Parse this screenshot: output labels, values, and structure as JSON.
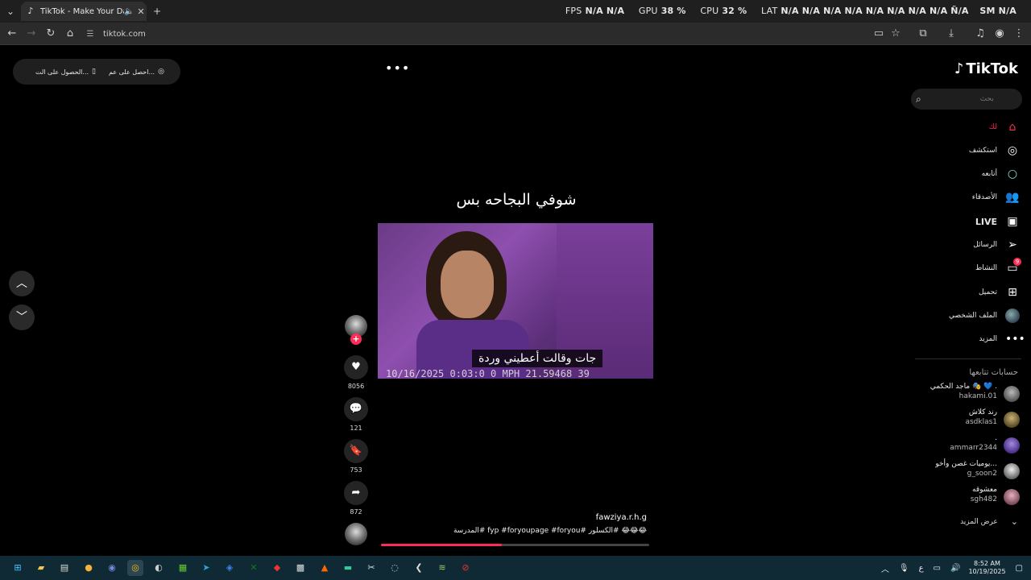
{
  "browser": {
    "tab_title": "TikTok - Make Your Day",
    "url": "tiktok.com",
    "stats": [
      {
        "label": "FPS",
        "value": "N/A  N/A"
      },
      {
        "label": "GPU",
        "value": "38 %"
      },
      {
        "label": "CPU",
        "value": "32 %"
      },
      {
        "label": "LAT",
        "value": "N/A  N/A  N/A  N/A  N/A  N/A  N/A  N/A  Ñ/A"
      }
    ],
    "stats_tail": "SM  N/A"
  },
  "topbar": {
    "get_app_label": "احصل على عم...",
    "get_desktop_label": "الحصول على الت..."
  },
  "video": {
    "title": "شوفي البجاحه بس",
    "subtitle": "جات وقالت أعطيني وردة",
    "stamp": "10/16/2025  0:03:0  0 MPH  21.59468  39",
    "author": "fawziya.r.h.g",
    "caption": "😂😂😂 #الكسلور #fyp #foryoupage #foryou #المدرسة",
    "progress": 0.45,
    "likes": "8056",
    "comments": "121",
    "saves": "753",
    "shares": "872"
  },
  "sidebar": {
    "logo": "TikTok",
    "search_placeholder": "بحث",
    "nav": [
      {
        "label": "لك",
        "icon": "home-icon"
      },
      {
        "label": "استكشف",
        "icon": "compass-icon"
      },
      {
        "label": "أتابعه",
        "icon": "following-icon"
      },
      {
        "label": "الأصدقاء",
        "icon": "friends-icon"
      },
      {
        "label": "LIVE",
        "icon": "live-icon"
      },
      {
        "label": "الرسائل",
        "icon": "messages-icon"
      },
      {
        "label": "النشاط",
        "icon": "activity-icon",
        "badge": "9"
      },
      {
        "label": "تحميل",
        "icon": "upload-icon"
      },
      {
        "label": "الملف الشخصي",
        "icon": "profile-icon"
      },
      {
        "label": "المزيد",
        "icon": "more-icon"
      }
    ],
    "following_title": "حسابات تتابعها",
    "following": [
      {
        "name": "ماجد الحكمي 🎭 💙 .",
        "user": "hakami.01"
      },
      {
        "name": "رند كلاش",
        "user": "asdklas1"
      },
      {
        "name": ".",
        "user": "ammarr2344"
      },
      {
        "name": "يوميات غصن وأخو...",
        "user": "g_soon2"
      },
      {
        "name": "معشوقه",
        "user": "sgh482"
      }
    ],
    "see_more": "عرض المزيد"
  },
  "taskbar": {
    "time": "8:52 AM",
    "date": "10/19/2025",
    "lang": "ع"
  },
  "colors": {
    "accent": "#fe2c55",
    "page_bg": "#000000",
    "taskbar_bg": "#0f2a35"
  }
}
